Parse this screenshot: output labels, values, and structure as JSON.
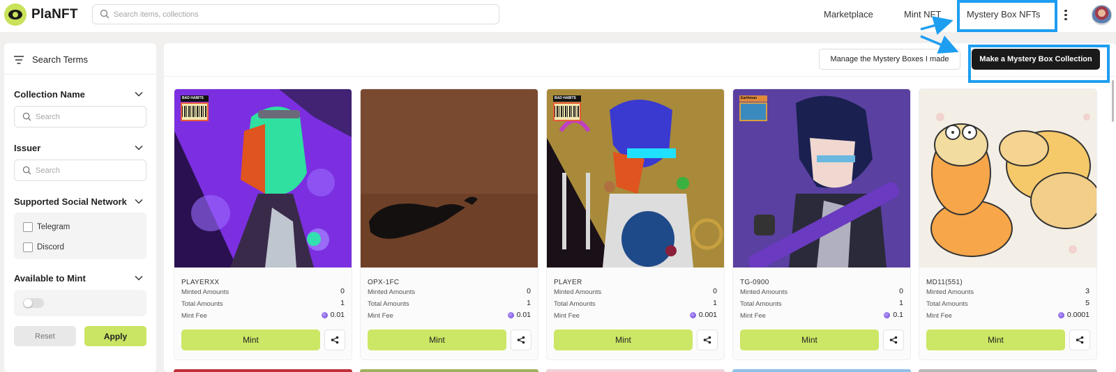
{
  "app": {
    "name": "PlaNFT"
  },
  "header": {
    "search_placeholder": "Search items, collections",
    "nav": {
      "marketplace": "Marketplace",
      "mint_nft": "Mint NFT",
      "mystery_box": "Mystery Box NFTs"
    }
  },
  "sidebar": {
    "title": "Search Terms",
    "collection_name": {
      "title": "Collection Name",
      "placeholder": "Search"
    },
    "issuer": {
      "title": "Issuer",
      "placeholder": "Search"
    },
    "social": {
      "title": "Supported Social Network",
      "options": [
        "Telegram",
        "Discord"
      ]
    },
    "available": {
      "title": "Available to Mint"
    },
    "reset_label": "Reset",
    "apply_label": "Apply"
  },
  "toolbar": {
    "manage_label": "Manage the Mystery Boxes I made",
    "make_label": "Make a Mystery Box Collection"
  },
  "card_labels": {
    "minted": "Minted Amounts",
    "total": "Total Amounts",
    "fee": "Mint Fee",
    "mint_button": "Mint"
  },
  "cards": [
    {
      "name": "PLAYERXX",
      "minted": "0",
      "total": "1",
      "fee": "0.01",
      "badge": "BAD HABITS"
    },
    {
      "name": "OPX-1FC",
      "minted": "0",
      "total": "1",
      "fee": "0.01"
    },
    {
      "name": "PLAYER",
      "minted": "0",
      "total": "1",
      "fee": "0.001",
      "badge": "BAD HABITS"
    },
    {
      "name": "TG-0900",
      "minted": "0",
      "total": "1",
      "fee": "0.1",
      "badge": "Earthman"
    },
    {
      "name": "MD11(551)",
      "minted": "3",
      "total": "5",
      "fee": "0.0001"
    }
  ],
  "colors": {
    "accent": "#cbe765",
    "dark_button": "#1a1a1a",
    "highlight": "#1e9ef0"
  }
}
